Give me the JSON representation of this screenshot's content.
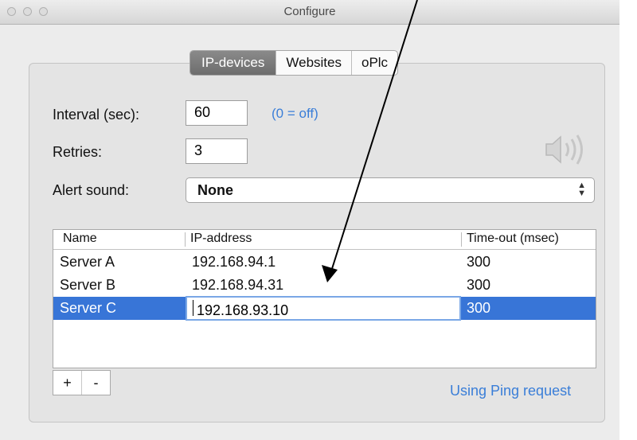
{
  "window": {
    "title": "Configure"
  },
  "tabs": [
    "IP-devices",
    "Websites",
    "oPlc"
  ],
  "form": {
    "interval_label": "Interval (sec):",
    "interval_value": "60",
    "interval_hint": "(0 = off)",
    "retries_label": "Retries:",
    "retries_value": "3",
    "alert_label": "Alert sound:",
    "alert_value": "None"
  },
  "table": {
    "headers": [
      "Name",
      "IP-address",
      "Time-out (msec)"
    ],
    "rows": [
      {
        "name": "Server A",
        "ip": "192.168.94.1",
        "timeout": "300"
      },
      {
        "name": "Server B",
        "ip": "192.168.94.31",
        "timeout": "300"
      },
      {
        "name": "Server C",
        "ip": "192.168.93.10",
        "timeout": "300"
      }
    ],
    "selected_row": 2
  },
  "buttons": {
    "add": "+",
    "remove": "-"
  },
  "status": "Using Ping request",
  "icons": [
    "speaker-icon",
    "up-down-arrows-icon"
  ],
  "colors": {
    "selection": "#3875d7",
    "link": "#3a7ed8"
  }
}
